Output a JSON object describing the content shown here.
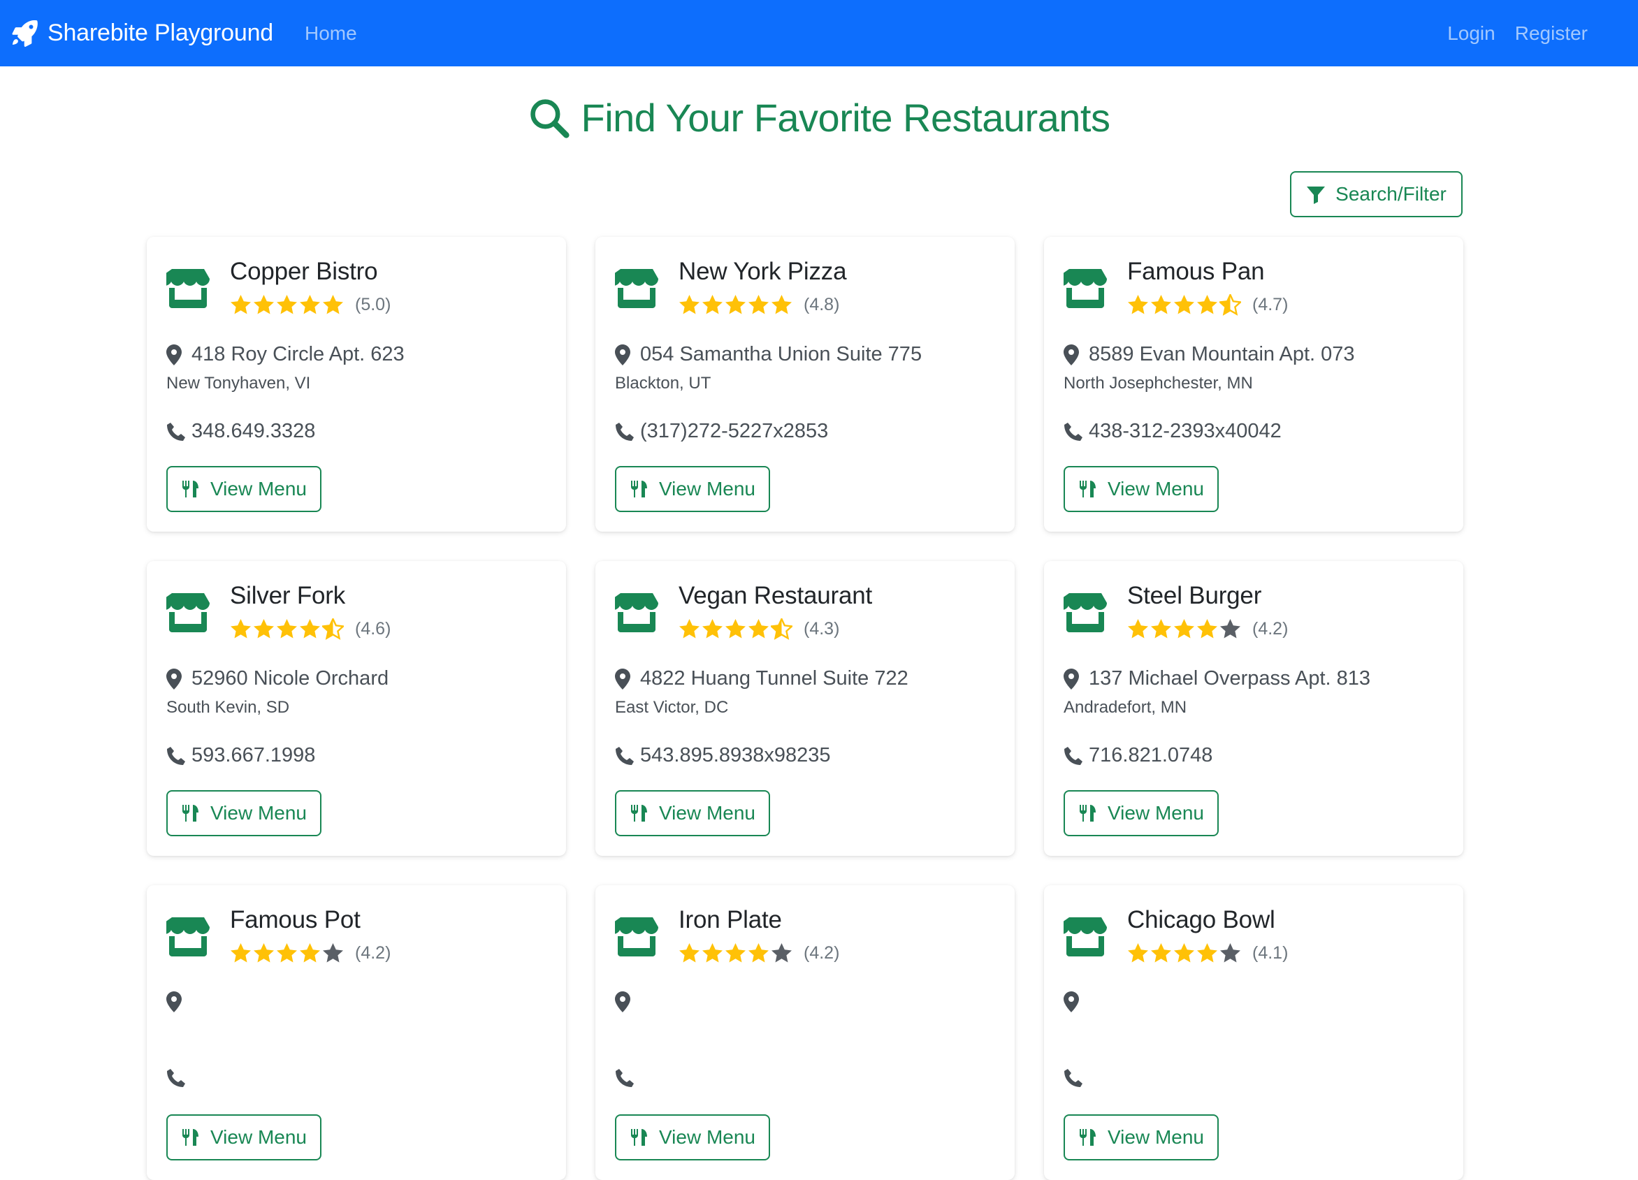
{
  "navbar": {
    "brand": "Sharebite Playground",
    "home": "Home",
    "login": "Login",
    "register": "Register"
  },
  "page": {
    "title": "Find Your Favorite Restaurants",
    "filter_label": "Search/Filter",
    "view_menu_label": "View Menu"
  },
  "colors": {
    "primary": "#0d6efd",
    "success": "#198754",
    "star": "#ffc107",
    "star_empty": "#5a5f66"
  },
  "restaurants": [
    {
      "name": "Copper Bistro",
      "rating": 5.0,
      "rating_text": "(5.0)",
      "address": "418 Roy Circle Apt. 623",
      "city": "New Tonyhaven, VI",
      "phone": "348.649.3328"
    },
    {
      "name": "New York Pizza",
      "rating": 4.8,
      "rating_text": "(4.8)",
      "address": "054 Samantha Union Suite 775",
      "city": "Blackton, UT",
      "phone": "(317)272-5227x2853"
    },
    {
      "name": "Famous Pan",
      "rating": 4.7,
      "rating_text": "(4.7)",
      "address": "8589 Evan Mountain Apt. 073",
      "city": "North Josephchester, MN",
      "phone": "438-312-2393x40042"
    },
    {
      "name": "Silver Fork",
      "rating": 4.6,
      "rating_text": "(4.6)",
      "address": "52960 Nicole Orchard",
      "city": "South Kevin, SD",
      "phone": "593.667.1998"
    },
    {
      "name": "Vegan Restaurant",
      "rating": 4.3,
      "rating_text": "(4.3)",
      "address": "4822 Huang Tunnel Suite 722",
      "city": "East Victor, DC",
      "phone": "543.895.8938x98235"
    },
    {
      "name": "Steel Burger",
      "rating": 4.2,
      "rating_text": "(4.2)",
      "address": "137 Michael Overpass Apt. 813",
      "city": "Andradefort, MN",
      "phone": "716.821.0748"
    },
    {
      "name": "Famous Pot",
      "rating": 4.2,
      "rating_text": "(4.2)",
      "address": "",
      "city": "",
      "phone": ""
    },
    {
      "name": "Iron Plate",
      "rating": 4.2,
      "rating_text": "(4.2)",
      "address": "",
      "city": "",
      "phone": ""
    },
    {
      "name": "Chicago Bowl",
      "rating": 4.1,
      "rating_text": "(4.1)",
      "address": "",
      "city": "",
      "phone": ""
    }
  ]
}
